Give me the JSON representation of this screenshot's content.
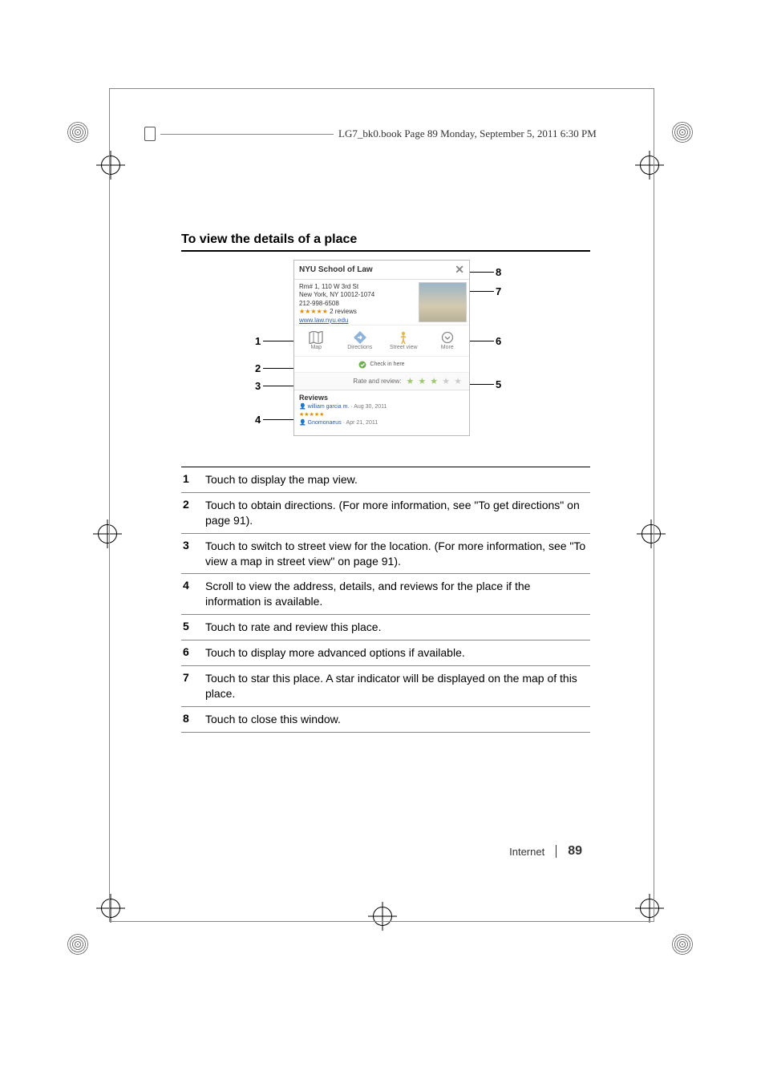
{
  "running_head": "LG7_bk0.book  Page 89  Monday, September 5, 2011   6:30 PM",
  "section_title": "To view the details of a place",
  "figure": {
    "title": "NYU School of Law",
    "address_line1": "Rm# 1, 110 W 3rd St",
    "address_line2": "New York, NY 10012-1074",
    "phone": "212-998-6508",
    "review_summary": "2 reviews",
    "url": "www.law.nyu.edu",
    "buttons": {
      "map": "Map",
      "directions": "Directions",
      "street_view": "Street view",
      "more": "More"
    },
    "checkin": "Check in here",
    "rate_label": "Rate and review:",
    "reviews_header": "Reviews",
    "reviews": [
      {
        "user": "william garcia m.",
        "date": "Aug 30, 2011"
      },
      {
        "user": "Gnomonaeus",
        "date": "Apr 21, 2011"
      }
    ],
    "callouts_left": [
      "1",
      "2",
      "3",
      "4"
    ],
    "callouts_right": [
      "8",
      "7",
      "6",
      "5"
    ]
  },
  "descriptions": [
    {
      "n": "1",
      "t": "Touch to display the map view."
    },
    {
      "n": "2",
      "t": "Touch to obtain directions. (For more information, see \"To get directions\" on page 91)."
    },
    {
      "n": "3",
      "t": "Touch to switch to street view for the location. (For more information, see \"To view a map in street view\" on page 91)."
    },
    {
      "n": "4",
      "t": "Scroll to view the address, details, and reviews for the place if the information is available."
    },
    {
      "n": "5",
      "t": "Touch to rate and review this place."
    },
    {
      "n": "6",
      "t": "Touch to display more advanced options if available."
    },
    {
      "n": "7",
      "t": "Touch to star this place. A star indicator will be displayed on the map of this place."
    },
    {
      "n": "8",
      "t": "Touch to close this window."
    }
  ],
  "footer": {
    "section": "Internet",
    "page": "89"
  }
}
